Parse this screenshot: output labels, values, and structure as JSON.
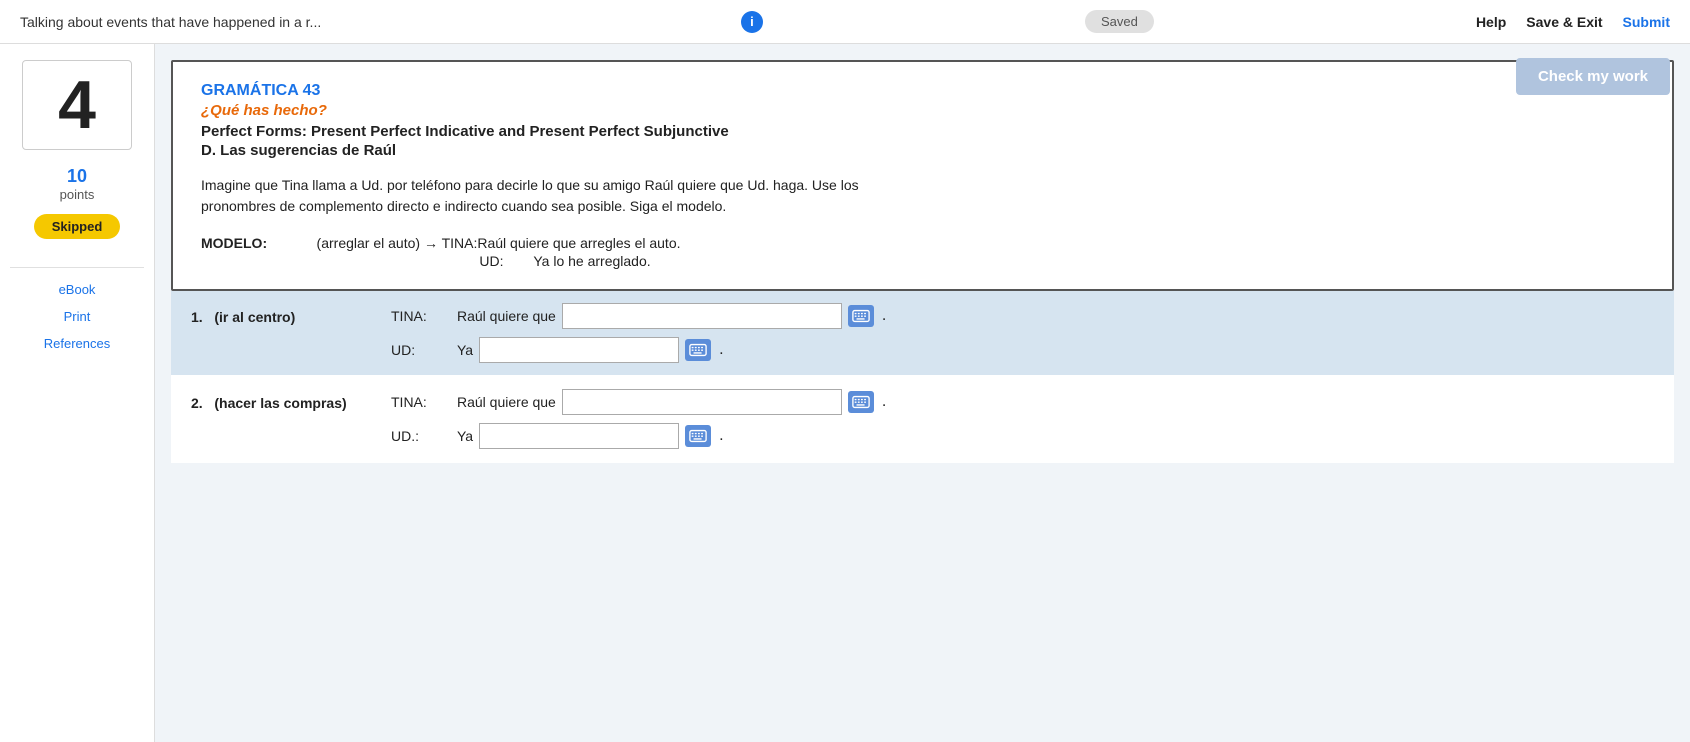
{
  "header": {
    "title": "Talking about events that have happened in a r...",
    "info_label": "i",
    "saved_label": "Saved",
    "help_label": "Help",
    "save_exit_label": "Save & Exit",
    "submit_label": "Submit"
  },
  "sidebar": {
    "question_number": "4",
    "points_value": "10",
    "points_label": "points",
    "skipped_label": "Skipped",
    "ebook_label": "eBook",
    "print_label": "Print",
    "references_label": "References"
  },
  "check_button_label": "Check my work",
  "grammar_card": {
    "label": "GRAMÁTICA 43",
    "subtitle": "¿Qué has hecho?",
    "title": "Perfect Forms: Present Perfect Indicative and Present Perfect Subjunctive",
    "section_title": "D. Las sugerencias de Raúl",
    "instructions": "Imagine que Tina llama a Ud. por teléfono para decirle lo que su amigo Raúl quiere que Ud. haga. Use los\npronombres de complemento directo e indirecto cuando sea posible. Siga el modelo.",
    "modelo_label": "MODELO:",
    "modelo_arrow": "(arreglar el auto) → TINA:",
    "modelo_tina_text": "Raúl quiere que arregles el auto.",
    "modelo_ud_label": "UD:",
    "modelo_ud_text": "Ya lo he arreglado."
  },
  "exercises": [
    {
      "number": "1.",
      "prompt": "(ir al centro)",
      "tina_label": "TINA:",
      "tina_prefix": "Raúl quiere que",
      "ud_label": "UD:",
      "ud_prefix": "Ya"
    },
    {
      "number": "2.",
      "prompt": "(hacer las compras)",
      "tina_label": "TINA:",
      "tina_prefix": "Raúl quiere que",
      "ud_label": "UD.:",
      "ud_prefix": "Ya"
    }
  ]
}
